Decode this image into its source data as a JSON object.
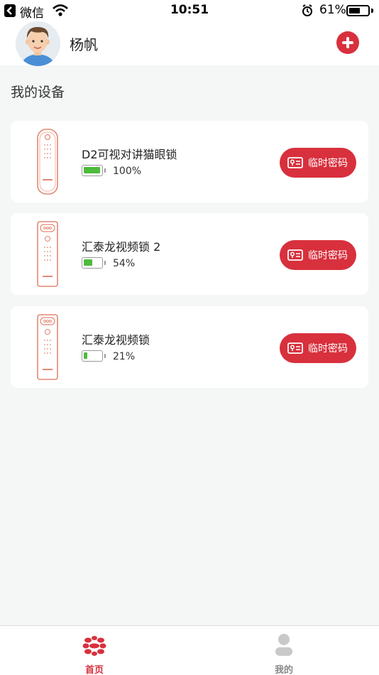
{
  "status_bar": {
    "back_app": "微信",
    "time": "10:51",
    "battery_percent": "61%",
    "battery_level": 0.61
  },
  "header": {
    "user_name": "杨帆"
  },
  "section_title": "我的设备",
  "devices": [
    {
      "name": "D2可视对讲猫眼锁",
      "battery": "100%",
      "battery_level": 1.0,
      "button_label": "临时密码"
    },
    {
      "name": "汇泰龙视频锁 2",
      "battery": "54%",
      "battery_level": 0.54,
      "button_label": "临时密码"
    },
    {
      "name": "汇泰龙视频锁",
      "battery": "21%",
      "battery_level": 0.21,
      "button_label": "临时密码"
    }
  ],
  "tabs": [
    {
      "label": "首页",
      "active": true,
      "icon": "home-logo-icon"
    },
    {
      "label": "我的",
      "active": false,
      "icon": "person-icon"
    }
  ],
  "colors": {
    "accent": "#d8303d",
    "battery_green": "#4dbb3b",
    "background": "#f5f6f6"
  }
}
